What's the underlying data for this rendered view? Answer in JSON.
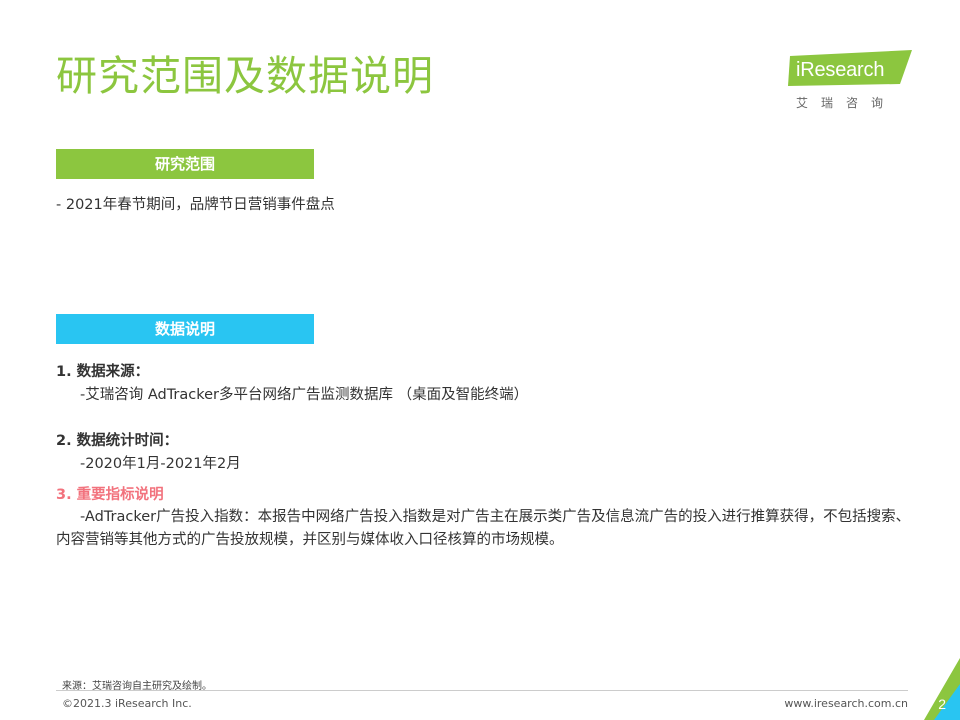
{
  "header": {
    "title": "研究范围及数据说明",
    "logo_text": "iResearch",
    "logo_subtitle": "艾瑞咨询"
  },
  "scope": {
    "heading": "研究范围",
    "line": "- 2021年春节期间，品牌节日营销事件盘点"
  },
  "data_notes": {
    "heading": "数据说明",
    "items": [
      {
        "head": "1.  数据来源：",
        "body": "-艾瑞咨询 AdTracker多平台网络广告监测数据库 （桌面及智能终端）"
      },
      {
        "head": "2.  数据统计时间：",
        "body": "-2020年1月-2021年2月"
      },
      {
        "head": "3.  重要指标说明",
        "body": "-AdTracker广告投入指数：本报告中网络广告投入指数是对广告主在展示类广告及信息流广告的投入进行推算获得，不包括搜索、内容营销等其他方式的广告投放规模，并区别与媒体收入口径核算的市场规模。"
      }
    ]
  },
  "footer": {
    "source": "来源：艾瑞咨询自主研究及绘制。",
    "copyright": "©2021.3 iResearch Inc.",
    "website": "www.iresearch.com.cn",
    "page_number": "2"
  },
  "colors": {
    "green": "#8cc63f",
    "blue": "#29c5f2",
    "highlight": "#f2727d"
  }
}
